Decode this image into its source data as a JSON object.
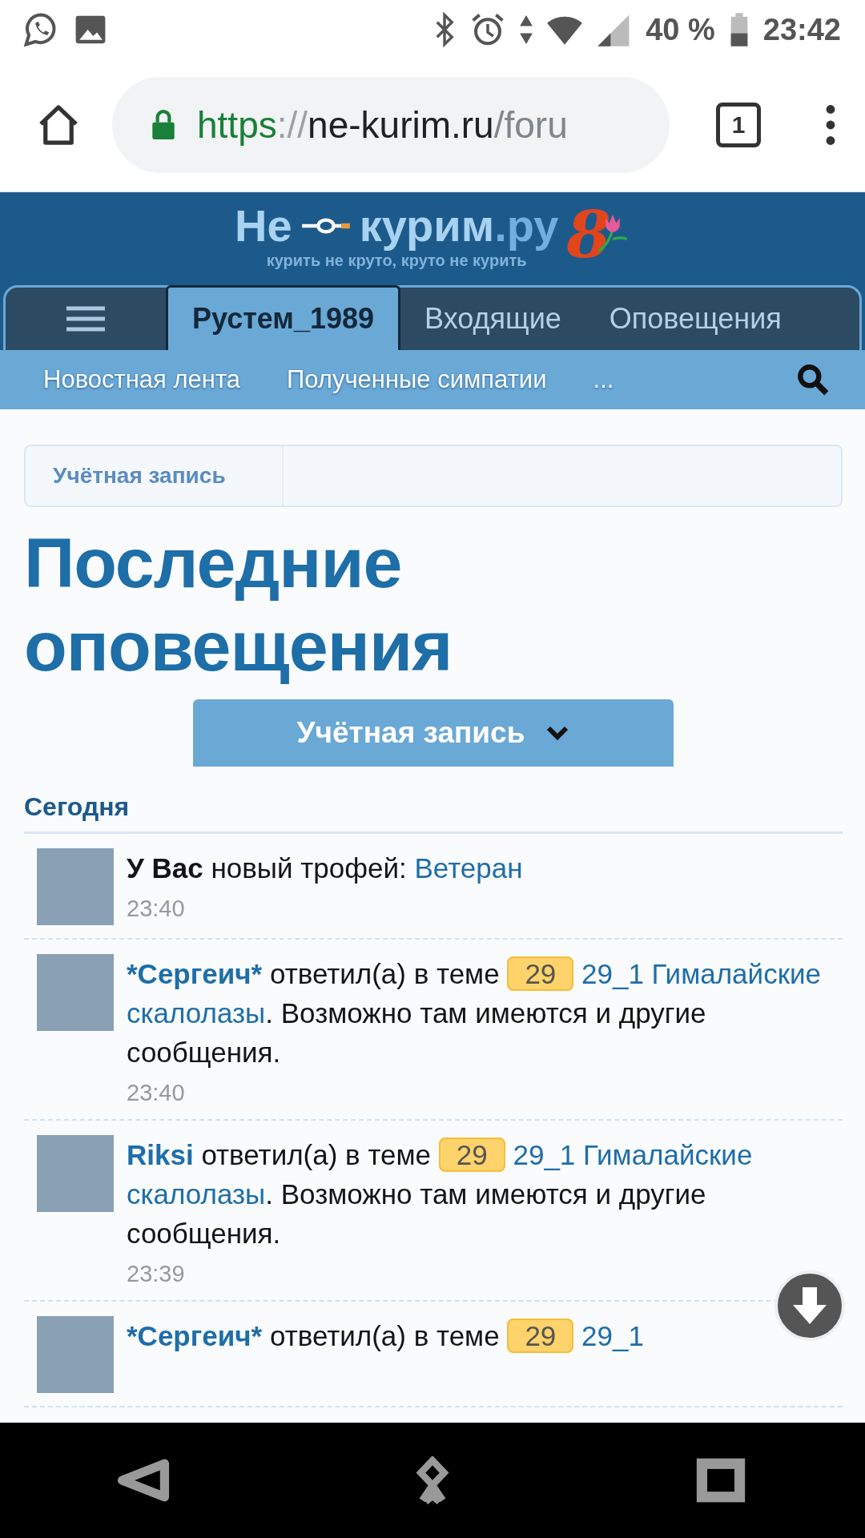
{
  "status_bar": {
    "battery": "40 %",
    "time": "23:42"
  },
  "browser": {
    "url": [
      {
        "kind": "scheme",
        "text": "https"
      },
      {
        "kind": "sep",
        "text": "://"
      },
      {
        "kind": "host",
        "text": "ne-kurim.ru"
      },
      {
        "kind": "path",
        "text": "/foru"
      }
    ],
    "tab_count": "1"
  },
  "logo": {
    "word_1": "Не",
    "word_2": "курим",
    "suffix": ".ру",
    "slogan": "курить не круто, круто не курить",
    "mark": "8"
  },
  "tabs": [
    {
      "kind": "menu",
      "selected": false
    },
    {
      "kind": "text",
      "label": "Рустем_1989",
      "selected": true
    },
    {
      "kind": "text",
      "label": "Входящие",
      "selected": false
    },
    {
      "kind": "text",
      "label": "Оповещения",
      "selected": false
    }
  ],
  "subnav": [
    "Новостная лента",
    "Полученные симпатии",
    "..."
  ],
  "breadcrumb": "Учётная запись",
  "title": "Последние оповещения",
  "dropdown": "Учётная запись",
  "section": "Сегодня",
  "alerts": [
    {
      "time": "23:40",
      "parts": [
        {
          "kind": "bold",
          "text": "У Вас"
        },
        {
          "kind": "text",
          "text": "новый трофей:"
        },
        {
          "kind": "link",
          "text": "Ветеран"
        }
      ]
    },
    {
      "time": "23:40",
      "parts": [
        {
          "kind": "user",
          "text": "*Сергеич*"
        },
        {
          "kind": "text",
          "text": "ответил(а) в теме"
        },
        {
          "kind": "badge",
          "text": "29"
        },
        {
          "kind": "link",
          "text": "29_1 Гималайские скалолазы"
        },
        {
          "kind": "tail",
          "text": ". Возможно там имеются и другие сообщения."
        }
      ]
    },
    {
      "time": "23:39",
      "parts": [
        {
          "kind": "user",
          "text": "Riksi"
        },
        {
          "kind": "text",
          "text": "ответил(а) в теме"
        },
        {
          "kind": "badge",
          "text": "29"
        },
        {
          "kind": "link",
          "text": "29_1 Гималайские скалолазы"
        },
        {
          "kind": "tail",
          "text": ". Возможно там имеются и другие сообщения."
        }
      ]
    },
    {
      "parts": [
        {
          "kind": "user",
          "text": "*Сергеич*"
        },
        {
          "kind": "text",
          "text": "ответил(а) в теме"
        },
        {
          "kind": "badge",
          "text": "29"
        },
        {
          "kind": "link",
          "text": "29_1"
        }
      ]
    }
  ]
}
